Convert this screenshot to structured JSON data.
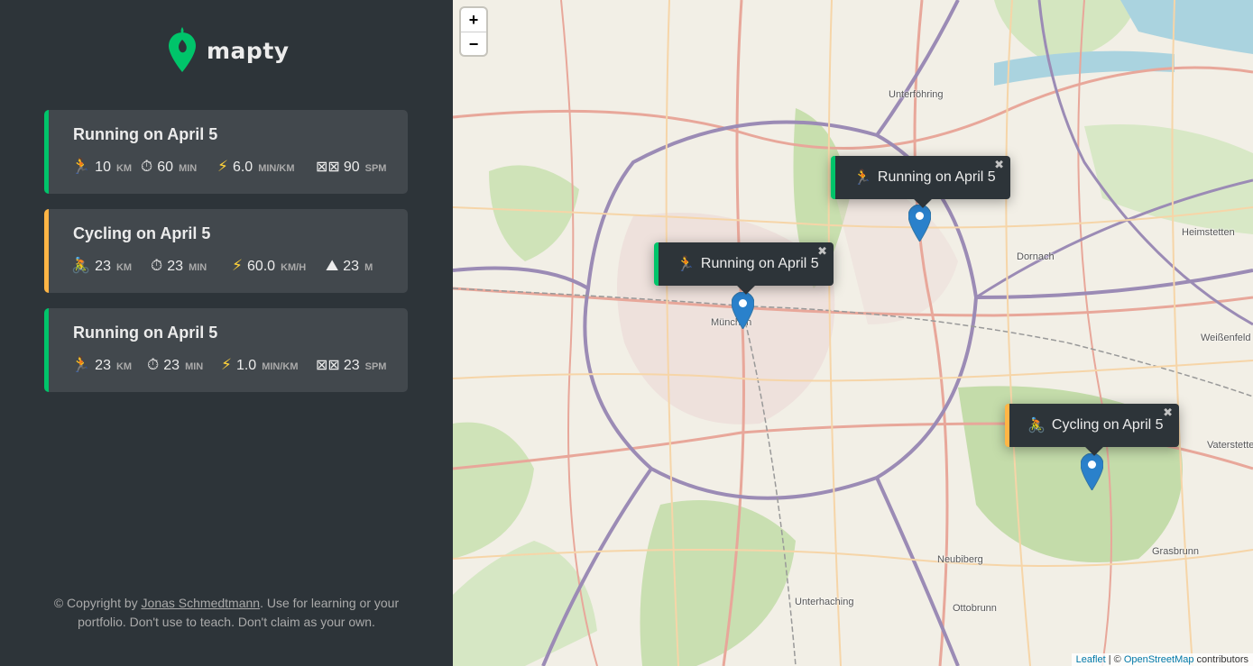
{
  "app": {
    "name": "mapty"
  },
  "workouts": [
    {
      "type": "running",
      "title": "Running on April 5",
      "details": [
        {
          "icon": "running-icon",
          "glyph": "🏃",
          "value": "10",
          "unit": "km"
        },
        {
          "icon": "stopwatch-icon",
          "glyph": "⏱",
          "value": "60",
          "unit": "min"
        },
        {
          "icon": "lightning-icon",
          "glyph": "⚡",
          "value": "6.0",
          "unit": "min/km"
        },
        {
          "icon": "footprints-icon",
          "glyph": "⊠⊠",
          "value": "90",
          "unit": "spm"
        }
      ]
    },
    {
      "type": "cycling",
      "title": "Cycling on April 5",
      "details": [
        {
          "icon": "cycling-icon",
          "glyph": "🚴",
          "value": "23",
          "unit": "km"
        },
        {
          "icon": "stopwatch-icon",
          "glyph": "⏱",
          "value": "23",
          "unit": "min"
        },
        {
          "icon": "lightning-icon",
          "glyph": "⚡",
          "value": "60.0",
          "unit": "km/h"
        },
        {
          "icon": "mountain-icon",
          "glyph": "⛰",
          "value": "23",
          "unit": "m"
        }
      ]
    },
    {
      "type": "running",
      "title": "Running on April 5",
      "details": [
        {
          "icon": "running-icon",
          "glyph": "🏃",
          "value": "23",
          "unit": "km"
        },
        {
          "icon": "stopwatch-icon",
          "glyph": "⏱",
          "value": "23",
          "unit": "min"
        },
        {
          "icon": "lightning-icon",
          "glyph": "⚡",
          "value": "1.0",
          "unit": "min/km"
        },
        {
          "icon": "footprints-icon",
          "glyph": "⊠⊠",
          "value": "23",
          "unit": "spm"
        }
      ]
    }
  ],
  "copyright": {
    "prefix": "© Copyright by ",
    "author": "Jonas Schmedtmann",
    "suffix": ". Use for learning or your portfolio. Don't use to teach. Don't claim as your own."
  },
  "map": {
    "zoom_in": "+",
    "zoom_out": "−",
    "popups": [
      {
        "type": "running",
        "glyph": "🏃",
        "text": "Running on April 5",
        "close": "✖"
      },
      {
        "type": "running",
        "glyph": "🏃",
        "text": "Running on April 5",
        "close": "✖"
      },
      {
        "type": "cycling",
        "glyph": "🚴",
        "text": "Cycling on April 5",
        "close": "✖"
      }
    ],
    "places": [
      "Unterföhring",
      "Dornach",
      "Heimstetten",
      "Weißenfeld",
      "München",
      "Vaterstetten",
      "Grasbrunn",
      "Neubiberg",
      "Unterhaching",
      "Ottobrunn"
    ],
    "attribution": {
      "leaflet": "Leaflet",
      "sep": " | © ",
      "osm": "OpenStreetMap",
      "suffix": " contributors"
    }
  },
  "colors": {
    "running": "#00c46a",
    "cycling": "#ffb545",
    "sidebar": "#2d3439",
    "card": "#42484d",
    "marker": "#2a81cb"
  }
}
